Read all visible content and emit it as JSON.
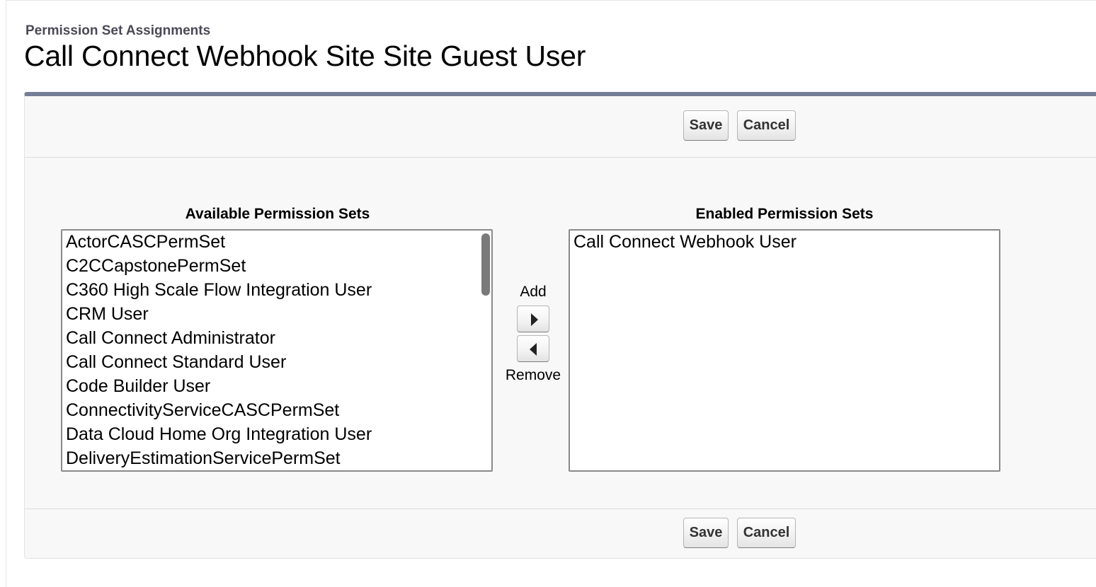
{
  "header": {
    "subtitle": "Permission Set Assignments",
    "title": "Call Connect Webhook Site Site Guest User"
  },
  "buttons": {
    "save_label": "Save",
    "cancel_label": "Cancel"
  },
  "available": {
    "label": "Available Permission Sets",
    "items": [
      "ActorCASCPermSet",
      "C2CCapstonePermSet",
      "C360 High Scale Flow Integration User",
      "CRM User",
      "Call Connect Administrator",
      "Call Connect Standard User",
      "Code Builder User",
      "ConnectivityServiceCASCPermSet",
      "Data Cloud Home Org Integration User",
      "DeliveryEstimationServicePermSet"
    ]
  },
  "enabled": {
    "label": "Enabled Permission Sets",
    "items": [
      "Call Connect Webhook User"
    ]
  },
  "mover": {
    "add_label": "Add",
    "remove_label": "Remove"
  },
  "icons": {
    "add": "arrow-right-icon",
    "remove": "arrow-left-icon"
  }
}
